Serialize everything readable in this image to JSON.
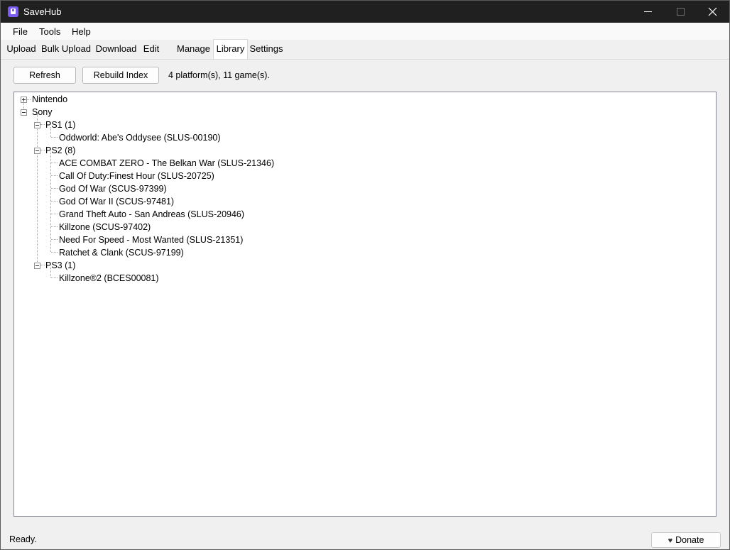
{
  "window": {
    "title": "SaveHub"
  },
  "menu": [
    "File",
    "Tools",
    "Help"
  ],
  "tabs": [
    "Upload",
    "Bulk Upload",
    "Download",
    "Edit",
    "Manage",
    "Library",
    "Settings"
  ],
  "active_tab": "Library",
  "toolbar": {
    "refresh": "Refresh",
    "rebuild": "Rebuild Index",
    "summary": "4 platform(s), 11 game(s)."
  },
  "tree": {
    "nintendo": "Nintendo",
    "sony": "Sony",
    "ps1": {
      "label": "PS1 (1)",
      "games": [
        "Oddworld: Abe's Oddysee (SLUS-00190)"
      ]
    },
    "ps2": {
      "label": "PS2 (8)",
      "games": [
        "ACE COMBAT ZERO - The Belkan War (SLUS-21346)",
        "Call Of Duty:Finest Hour (SLUS-20725)",
        "God Of War (SCUS-97399)",
        "God Of War II (SCUS-97481)",
        "Grand Theft Auto - San Andreas (SLUS-20946)",
        "Killzone (SCUS-97402)",
        "Need For Speed - Most Wanted (SLUS-21351)",
        "Ratchet & Clank (SCUS-97199)"
      ]
    },
    "ps3": {
      "label": "PS3 (1)",
      "games": [
        "Killzone®2 (BCES00081)"
      ]
    }
  },
  "status": {
    "text": "Ready.",
    "donate": "Donate"
  },
  "colors": {
    "titlebar": "#202020",
    "app_icon": "#7b5cf0",
    "background": "#f0f0f0"
  },
  "icons": [
    "app-icon",
    "minimize-icon",
    "maximize-icon",
    "close-icon",
    "expand-icon",
    "collapse-icon",
    "heart-icon"
  ]
}
